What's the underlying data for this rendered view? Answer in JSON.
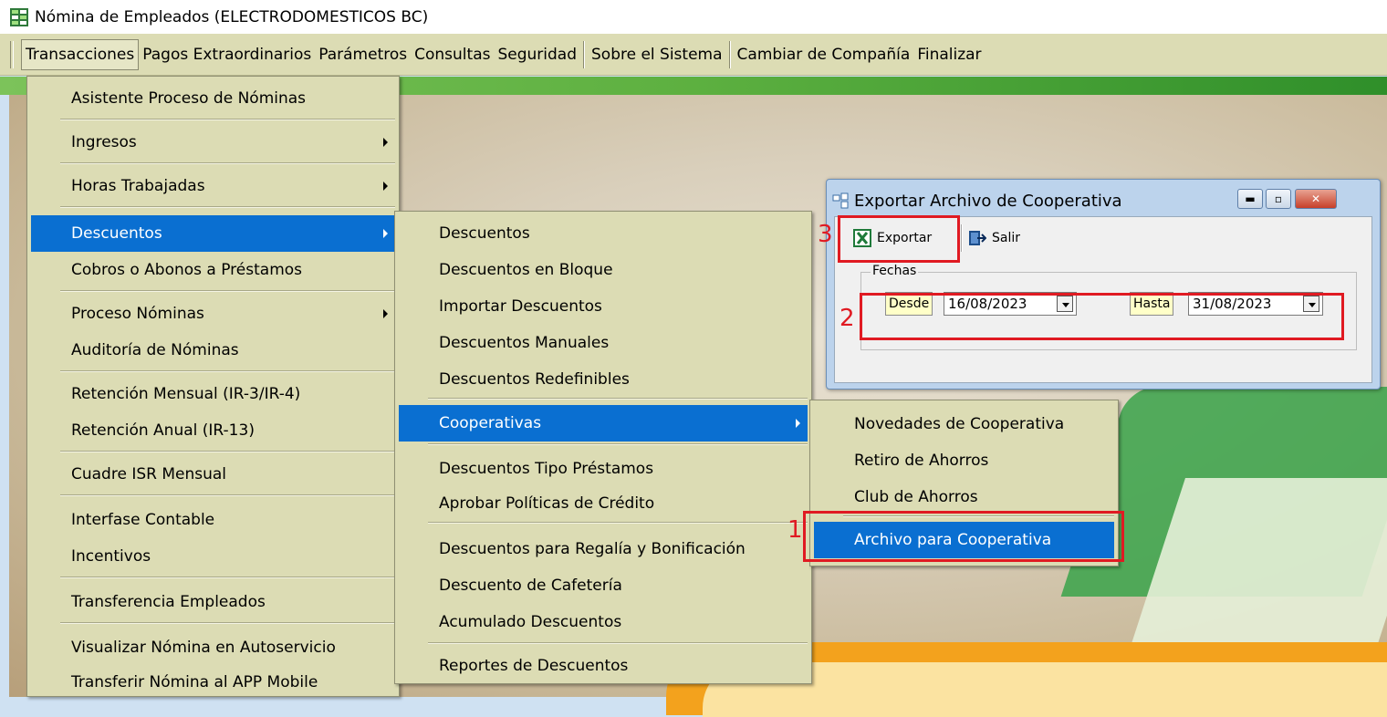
{
  "window": {
    "title": "Nómina de Empleados (ELECTRODOMESTICOS BC)"
  },
  "menubar": {
    "items": [
      "Transacciones",
      "Pagos Extraordinarios",
      "Parámetros",
      "Consultas",
      "Seguridad",
      "Sobre el Sistema",
      "Cambiar de Compañía",
      "Finalizar"
    ]
  },
  "menu_transacciones": {
    "items": [
      "Asistente Proceso de Nóminas",
      "Ingresos",
      "Horas Trabajadas",
      "Descuentos",
      "Cobros o Abonos a Préstamos",
      "Proceso Nóminas",
      "Auditoría de Nóminas",
      "Retención Mensual  (IR-3/IR-4)",
      "Retención Anual  (IR-13)",
      "Cuadre ISR Mensual",
      "Interfase Contable",
      "Incentivos",
      "Transferencia Empleados",
      "Visualizar Nómina en Autoservicio",
      "Transferir Nómina al APP Mobile"
    ]
  },
  "menu_descuentos": {
    "items": [
      "Descuentos",
      "Descuentos en Bloque",
      "Importar Descuentos",
      "Descuentos Manuales",
      "Descuentos Redefinibles",
      "Cooperativas",
      "Descuentos Tipo Préstamos",
      "Aprobar Políticas de Crédito",
      "Descuentos  para Regalía y Bonificación",
      "Descuento de Cafetería",
      "Acumulado Descuentos",
      "Reportes de Descuentos"
    ]
  },
  "menu_cooperativas": {
    "items": [
      "Novedades de Cooperativa",
      "Retiro de Ahorros",
      "Club de Ahorros",
      "Archivo para Cooperativa"
    ]
  },
  "dialog": {
    "title": "Exportar Archivo de Cooperativa",
    "export_label": "Exportar",
    "exit_label": "Salir",
    "group_label": "Fechas",
    "from_label": "Desde",
    "from_value": "16/08/2023",
    "to_label": "Hasta",
    "to_value": "31/08/2023"
  },
  "annotations": {
    "step1": "1",
    "step2": "2",
    "step3": "3"
  },
  "colors": {
    "menu_bg": "#dcdcb4",
    "selection": "#0a6fd1",
    "annotation_red": "#e01a22"
  },
  "icons": {
    "app": "grid-app-icon",
    "excel": "excel-icon",
    "exit": "exit-door-icon"
  }
}
